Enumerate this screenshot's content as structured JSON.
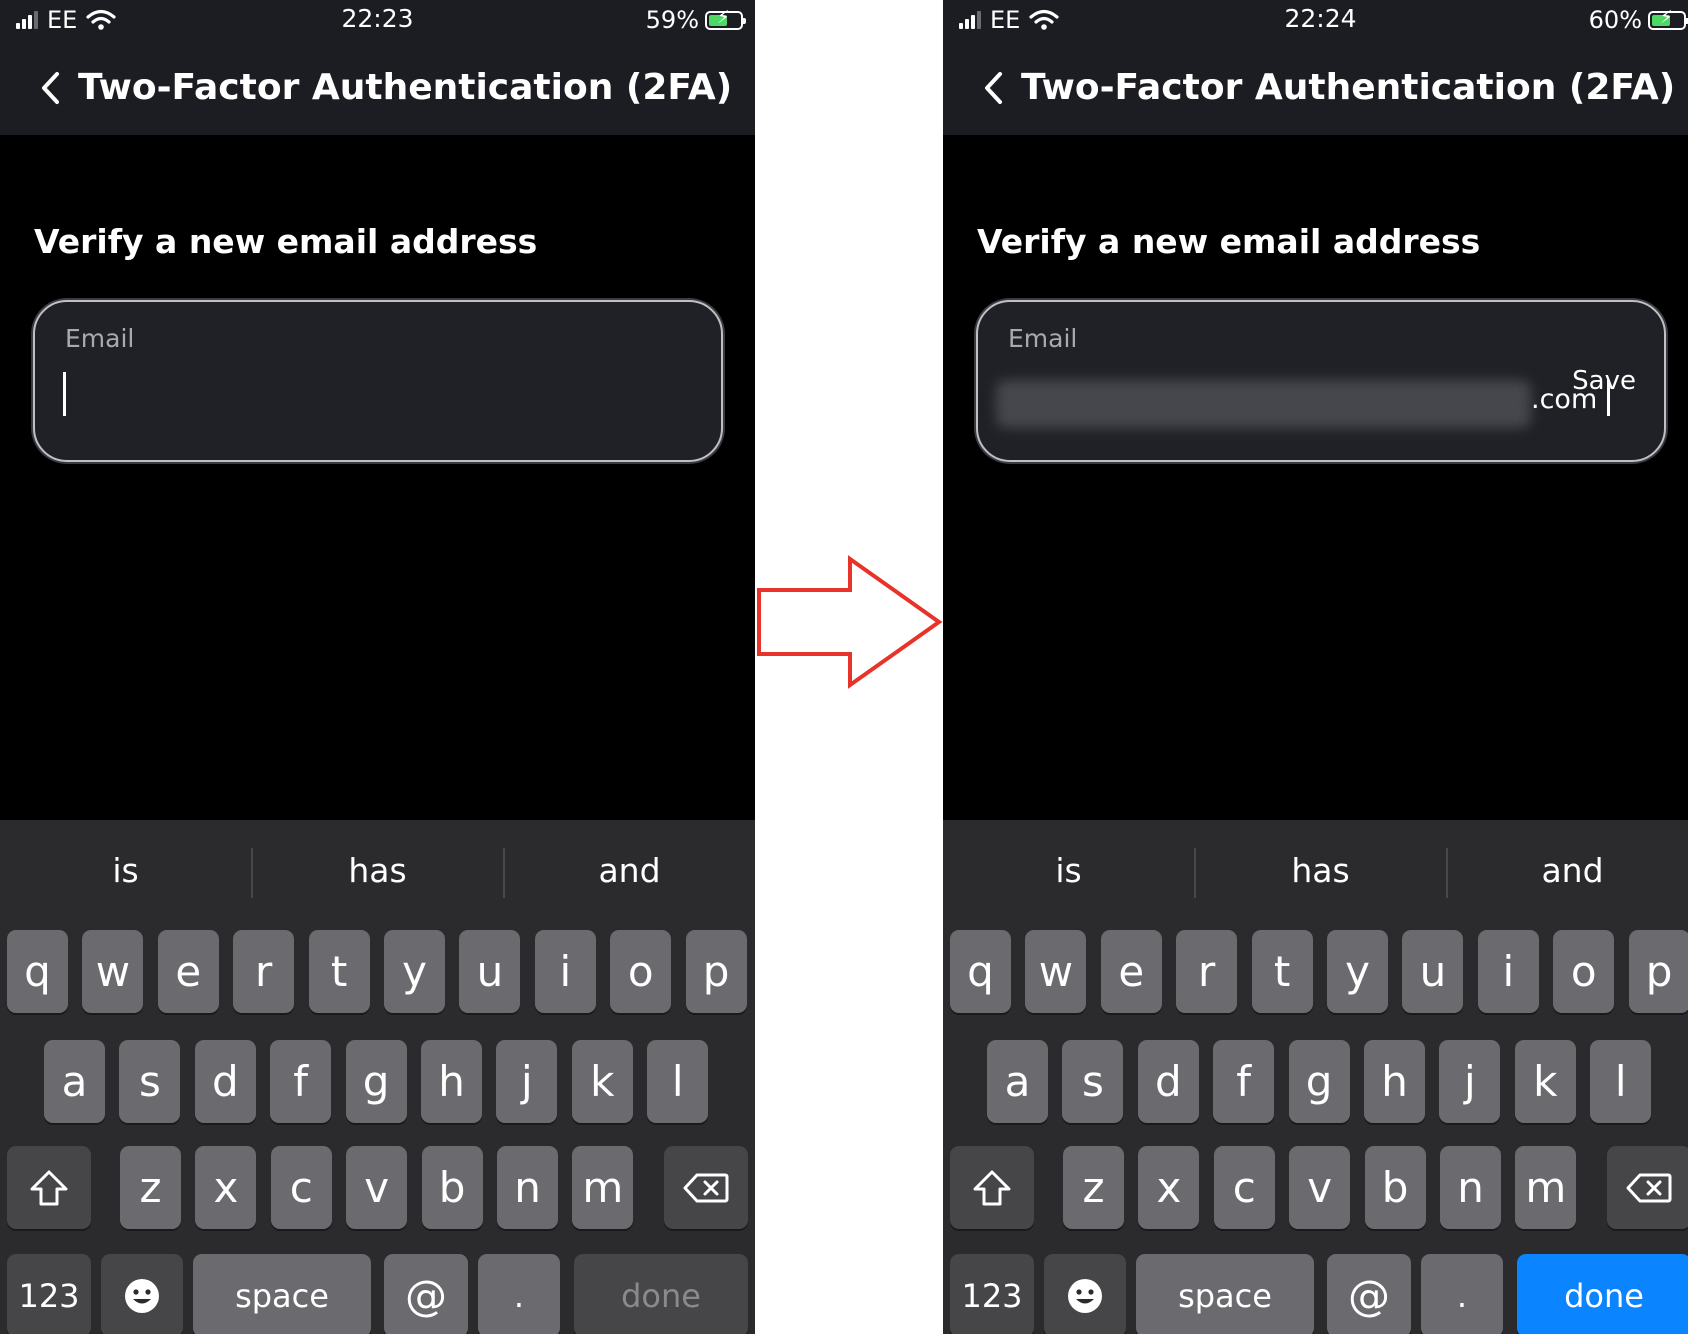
{
  "panels": [
    {
      "status": {
        "carrier": "EE",
        "time": "22:23",
        "battery": "59%",
        "battery_level": 0.59
      },
      "nav": {
        "title": "Two-Factor Authentication (2FA)"
      },
      "section_title": "Verify a new email address",
      "email_field": {
        "label": "Email",
        "value": "",
        "save_label": ""
      },
      "suggestions": [
        "is",
        "has",
        "and"
      ],
      "keys": {
        "row1": [
          "q",
          "w",
          "e",
          "r",
          "t",
          "y",
          "u",
          "i",
          "o",
          "p"
        ],
        "row2": [
          "a",
          "s",
          "d",
          "f",
          "g",
          "h",
          "j",
          "k",
          "l"
        ],
        "row3": [
          "z",
          "x",
          "c",
          "v",
          "b",
          "n",
          "m"
        ],
        "num": "123",
        "space": "space",
        "at": "@",
        "dot": ".",
        "done": "done"
      },
      "done_enabled": false
    },
    {
      "status": {
        "carrier": "EE",
        "time": "22:24",
        "battery": "60%",
        "battery_level": 0.6
      },
      "nav": {
        "title": "Two-Factor Authentication (2FA)"
      },
      "section_title": "Verify a new email address",
      "email_field": {
        "label": "Email",
        "value": ".com",
        "save_label": "Save"
      },
      "suggestions": [
        "is",
        "has",
        "and"
      ],
      "keys": {
        "row1": [
          "q",
          "w",
          "e",
          "r",
          "t",
          "y",
          "u",
          "i",
          "o",
          "p"
        ],
        "row2": [
          "a",
          "s",
          "d",
          "f",
          "g",
          "h",
          "j",
          "k",
          "l"
        ],
        "row3": [
          "z",
          "x",
          "c",
          "v",
          "b",
          "n",
          "m"
        ],
        "num": "123",
        "space": "space",
        "at": "@",
        "dot": ".",
        "done": "done"
      },
      "done_enabled": true
    }
  ],
  "colors": {
    "arrow": "#e8332a",
    "done_active": "#0a84ff",
    "battery_fill": "#4cd964"
  }
}
